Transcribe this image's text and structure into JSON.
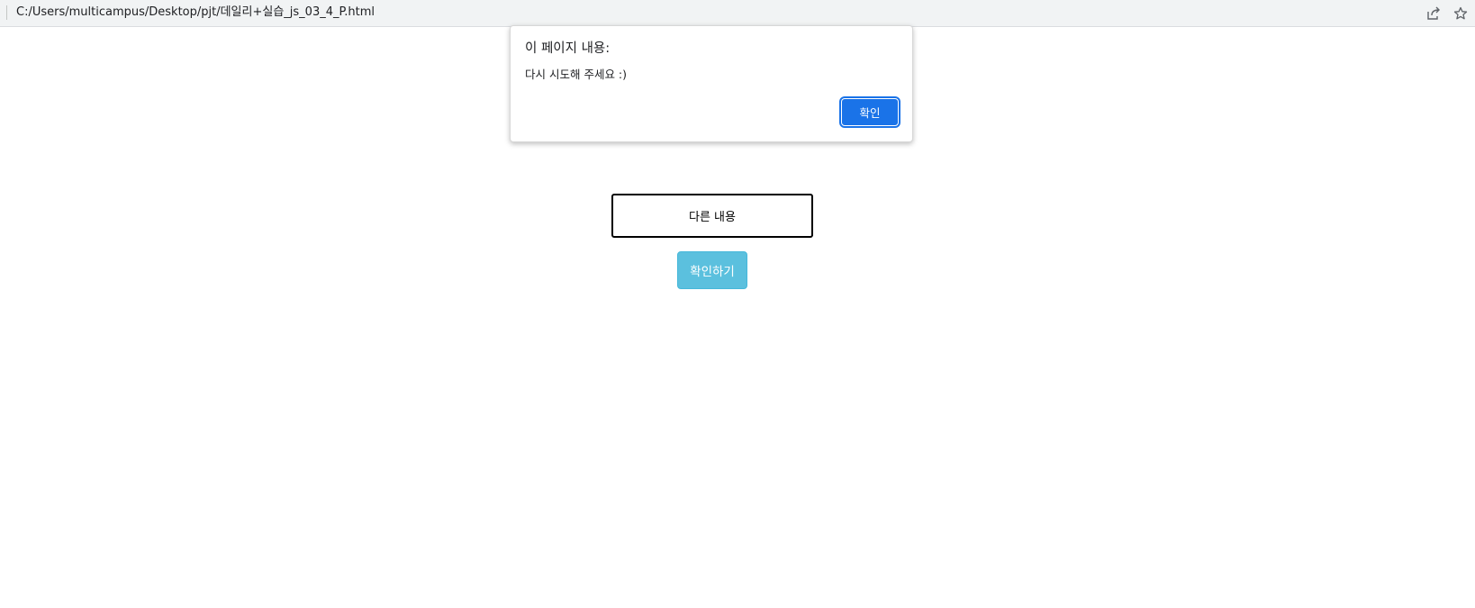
{
  "browser": {
    "url": "C:/Users/multicampus/Desktop/pjt/데일리+실습_js_03_4_P.html",
    "icons": [
      "share-icon",
      "star-icon"
    ]
  },
  "alert_dialog": {
    "title": "이 페이지 내용:",
    "message": "다시 시도해 주세요 :)",
    "ok_label": "확인",
    "ok_color": "#1a73e8"
  },
  "main": {
    "input_value": "다른 내용",
    "confirm_label": "확인하기",
    "confirm_color": "#5bc0de"
  }
}
